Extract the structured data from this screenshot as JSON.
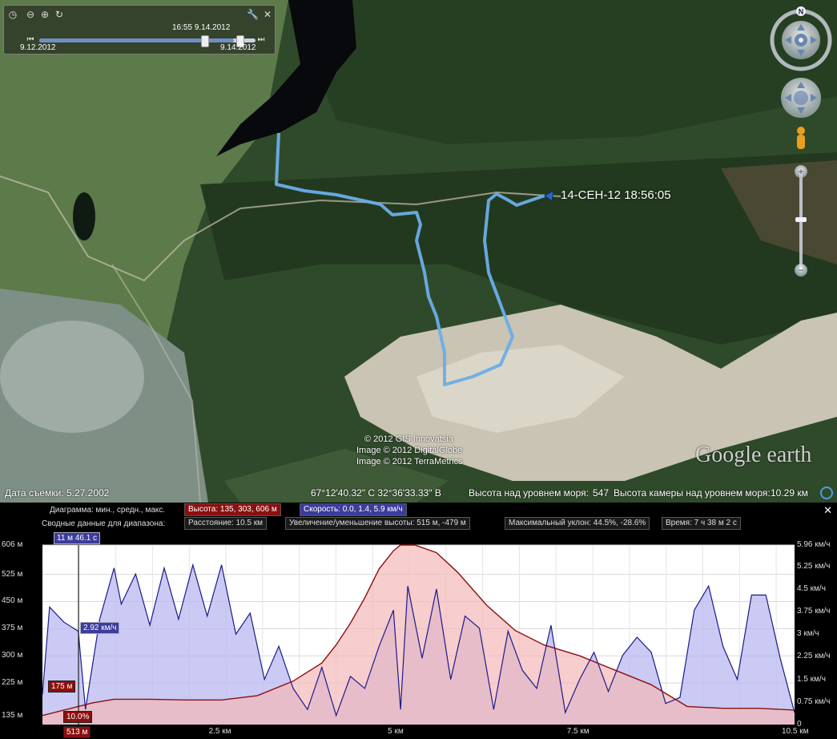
{
  "timeslider": {
    "current": "16:55 9.14.2012",
    "start": "9.12.2012",
    "end": "9.14.2012"
  },
  "track": {
    "label": "14-СЕН-12 18:56:05",
    "color": "#6aaee8"
  },
  "copyright": {
    "line1": "© 2012 GIS Innovatsia",
    "line2": "Image © 2012 DigitalGlobe",
    "line3": "Image © 2012 TerraMetrics",
    "logo": "Google earth"
  },
  "statusbar": {
    "date_label": "Дата съемки: 5.27.2002",
    "coords": "67°12'40.32\" С  32°36'33.33\" В",
    "elev_label": "Высота над уровнем моря:",
    "elev_value": "547",
    "cam_label": "Высота камеры над уровнем моря:",
    "cam_value": "10.29 км"
  },
  "profile": {
    "chart_label": "Диаграмма: мин., средн., макс.",
    "height_box": "Высота: 135, 303, 606 м",
    "speed_box": "Скорость: 0.0, 1.4, 5.9 км/ч",
    "summary_label": "Сводные данные для диапазона:",
    "distance_box": "Расстояние: 10.5 км",
    "gain_box": "Увеличение/уменьшение высоты: 515 м, -479 м",
    "slope_box": "Максимальный уклон: 44.5%, -28.6%",
    "time_box": "Время: 7 ч 38 м 2 с",
    "cursor_time": "11 м 46.1 с",
    "cursor_speed": "2.92 км/ч",
    "cursor_elev": "175 м",
    "cursor_slope": "10.0%",
    "cursor_bottom": "513 м",
    "close": "✕",
    "colors": {
      "elevation": "#8b1010",
      "speed": "#1a1a8a",
      "elev_fill": "#f4b8b8",
      "speed_fill": "#b8b8f0"
    }
  },
  "chart_data": {
    "type": "area",
    "xlabel": "",
    "x_ticks": [
      "2.5 км",
      "5 км",
      "7.5 км",
      "10.5 км"
    ],
    "x_tick_values": [
      2.5,
      5,
      7.5,
      10.5
    ],
    "xlim": [
      0,
      10.5
    ],
    "y_left_ticks": [
      "606 м",
      "525 м",
      "450 м",
      "375 м",
      "300 м",
      "225 м",
      "135 м"
    ],
    "y_left_values": [
      606,
      525,
      450,
      375,
      300,
      225,
      135
    ],
    "y_left_lim": [
      110,
      606
    ],
    "y_right_ticks": [
      "5.96 км/ч",
      "5.25 км/ч",
      "4.5 км/ч",
      "3.75 км/ч",
      "3 км/ч",
      "2.25 км/ч",
      "1.5 км/ч",
      "0.75 км/ч",
      "0"
    ],
    "y_right_values": [
      5.96,
      5.25,
      4.5,
      3.75,
      3,
      2.25,
      1.5,
      0.75,
      0
    ],
    "y_right_lim": [
      0,
      5.96
    ],
    "series": [
      {
        "name": "Высота",
        "x": [
          0,
          0.3,
          0.7,
          1.0,
          1.5,
          2.0,
          2.5,
          3.0,
          3.5,
          3.9,
          4.1,
          4.3,
          4.5,
          4.7,
          4.9,
          5.0,
          5.2,
          5.5,
          5.8,
          6.2,
          6.6,
          7.0,
          7.5,
          8.0,
          8.5,
          9.0,
          9.5,
          10.0,
          10.5
        ],
        "y": [
          135,
          150,
          170,
          180,
          180,
          178,
          178,
          190,
          230,
          280,
          330,
          390,
          460,
          540,
          590,
          606,
          606,
          585,
          530,
          440,
          370,
          330,
          300,
          260,
          220,
          160,
          155,
          155,
          150
        ]
      },
      {
        "name": "Скорость",
        "x": [
          0,
          0.1,
          0.3,
          0.5,
          0.6,
          0.8,
          1.0,
          1.1,
          1.3,
          1.5,
          1.7,
          1.9,
          2.1,
          2.3,
          2.5,
          2.7,
          2.9,
          3.1,
          3.3,
          3.5,
          3.7,
          3.9,
          4.1,
          4.3,
          4.5,
          4.7,
          4.9,
          5.0,
          5.1,
          5.3,
          5.5,
          5.7,
          5.9,
          6.1,
          6.3,
          6.5,
          6.7,
          6.9,
          7.1,
          7.3,
          7.5,
          7.7,
          7.9,
          8.1,
          8.3,
          8.5,
          8.7,
          8.9,
          9.1,
          9.3,
          9.5,
          9.7,
          9.9,
          10.1,
          10.3,
          10.5
        ],
        "y": [
          1.0,
          3.9,
          3.4,
          3.1,
          0.5,
          3.5,
          5.2,
          4.0,
          5.0,
          3.3,
          5.2,
          3.5,
          5.3,
          3.6,
          5.3,
          3.0,
          3.7,
          1.5,
          2.6,
          1.2,
          0.5,
          1.9,
          0.3,
          1.6,
          1.2,
          2.6,
          3.8,
          0.5,
          4.6,
          2.2,
          4.5,
          1.5,
          3.6,
          3.2,
          0.5,
          3.1,
          1.8,
          1.2,
          3.3,
          0.4,
          1.5,
          2.4,
          1.1,
          2.3,
          2.9,
          2.4,
          0.7,
          0.9,
          3.8,
          4.6,
          2.6,
          1.5,
          4.3,
          4.3,
          2.2,
          0.4
        ]
      }
    ]
  }
}
